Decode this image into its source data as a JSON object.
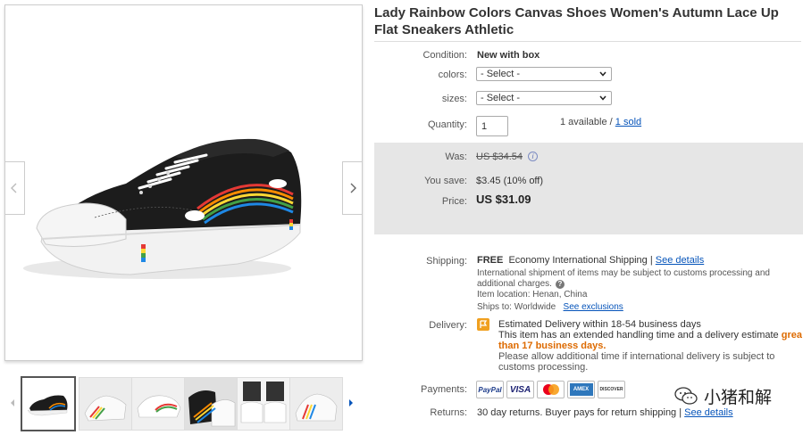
{
  "product": {
    "title": "Lady Rainbow Colors Canvas Shoes Women's Autumn Lace Up Flat Sneakers Athletic"
  },
  "condition": {
    "label": "Condition:",
    "value": "New with box"
  },
  "colors": {
    "label": "colors:",
    "selected": "- Select -"
  },
  "sizes": {
    "label": "sizes:",
    "selected": "- Select -"
  },
  "quantity": {
    "label": "Quantity:",
    "value": "1",
    "available_text": "1 available /",
    "sold_link": "1 sold"
  },
  "price": {
    "was_label": "Was:",
    "was_value": "US $34.54",
    "save_label": "You save:",
    "save_value": "$3.45 (10% off)",
    "price_label": "Price:",
    "price_value": "US $31.09",
    "info_icon": "i"
  },
  "shipping": {
    "label": "Shipping:",
    "free": "FREE",
    "method": "Economy International Shipping |",
    "details_link": "See details",
    "note": "International shipment of items may be subject to customs processing and additional charges.",
    "help_icon": "?",
    "location_label": "Item location:",
    "location_value": "Henan, China",
    "ships_to_label": "Ships to:",
    "ships_to_value": "Worldwide",
    "exclusions_link": "See exclusions"
  },
  "delivery": {
    "label": "Delivery:",
    "estimate": "Estimated Delivery within 18-54 business days",
    "handling_prefix": "This item has an extended handling time and a delivery estimate",
    "handling_highlight_1": "great",
    "handling_highlight_2": "than 17 business days.",
    "allow_text": "Please allow additional time if international delivery is subject to customs processing."
  },
  "payments": {
    "label": "Payments:",
    "methods": [
      "PayPal",
      "VISA",
      "MasterCard",
      "AMEX",
      "DISCOVER"
    ]
  },
  "returns": {
    "label": "Returns:",
    "text": "30 day returns. Buyer pays for return shipping |",
    "details_link": "See details"
  },
  "watermark": {
    "text": "小猪和解"
  },
  "icons": {
    "gallery_prev": "chevron-left-icon",
    "gallery_next": "chevron-right-icon",
    "thumbs_prev": "triangle-left-icon",
    "thumbs_next": "triangle-right-icon",
    "info": "info-icon",
    "help": "question-icon",
    "delivery_flag": "flag-icon",
    "watermark": "wechat-icon"
  },
  "colors_palette": {
    "link": "#0654ba",
    "price_box": "#e6e6e6",
    "accent_orange": "#dd6a00",
    "shoe_body": "#1a1a1a"
  }
}
